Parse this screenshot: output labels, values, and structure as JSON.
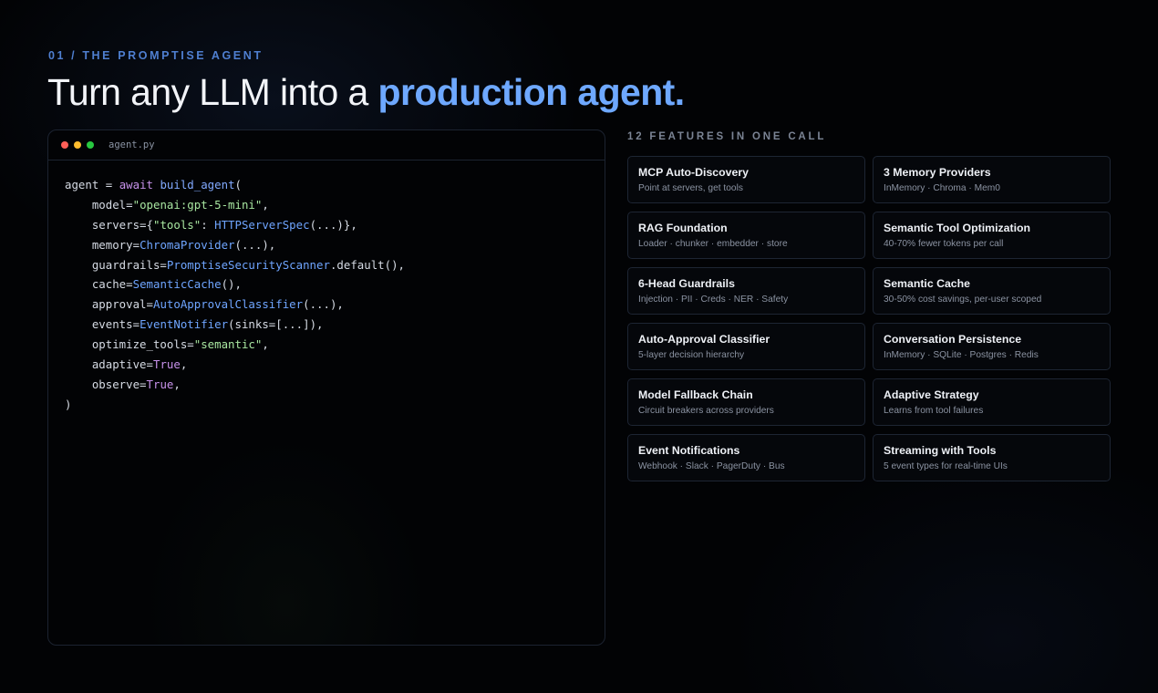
{
  "header": {
    "eyebrow": "01 / THE PROMPTISE AGENT",
    "title_plain": "Turn any LLM into a ",
    "title_accent": "production agent."
  },
  "editor": {
    "filename": "agent.py",
    "code": {
      "l1_a": "agent = ",
      "l1_kw": "await",
      "l1_sp": " ",
      "l1_fn": "build_agent",
      "l1_b": "(",
      "l2_a": "    model=",
      "l2_str": "\"openai:gpt-5-mini\"",
      "l2_b": ",",
      "l3_a": "    servers={",
      "l3_str": "\"tools\"",
      "l3_b": ": ",
      "l3_cls": "HTTPServerSpec",
      "l3_c": "(...)},",
      "l4_a": "    memory=",
      "l4_cls": "ChromaProvider",
      "l4_b": "(...),",
      "l5_a": "    guardrails=",
      "l5_cls": "PromptiseSecurityScanner",
      "l5_b": ".default(),",
      "l6_a": "    cache=",
      "l6_cls": "SemanticCache",
      "l6_b": "(),",
      "l7_a": "    approval=",
      "l7_cls": "AutoApprovalClassifier",
      "l7_b": "(...),",
      "l8_a": "    events=",
      "l8_cls": "EventNotifier",
      "l8_b": "(sinks=[...]),",
      "l9_a": "    optimize_tools=",
      "l9_str": "\"semantic\"",
      "l9_b": ",",
      "l10_a": "    adaptive=",
      "l10_bool": "True",
      "l10_b": ",",
      "l11_a": "    observe=",
      "l11_bool": "True",
      "l11_b": ",",
      "l12": ")"
    },
    "colors": {
      "dot_red": "#ff5f57",
      "dot_yellow": "#febc2e",
      "dot_green": "#28c840"
    }
  },
  "features": {
    "heading": "12 FEATURES IN ONE CALL",
    "items": [
      {
        "title": "MCP Auto-Discovery",
        "desc": "Point at servers, get tools"
      },
      {
        "title": "3 Memory Providers",
        "desc": "InMemory · Chroma · Mem0"
      },
      {
        "title": "RAG Foundation",
        "desc": "Loader · chunker · embedder · store"
      },
      {
        "title": "Semantic Tool Optimization",
        "desc": "40-70% fewer tokens per call"
      },
      {
        "title": "6-Head Guardrails",
        "desc": "Injection · PII · Creds · NER · Safety"
      },
      {
        "title": "Semantic Cache",
        "desc": "30-50% cost savings, per-user scoped"
      },
      {
        "title": "Auto-Approval Classifier",
        "desc": "5-layer decision hierarchy"
      },
      {
        "title": "Conversation Persistence",
        "desc": "InMemory · SQLite · Postgres · Redis"
      },
      {
        "title": "Model Fallback Chain",
        "desc": "Circuit breakers across providers"
      },
      {
        "title": "Adaptive Strategy",
        "desc": "Learns from tool failures"
      },
      {
        "title": "Event Notifications",
        "desc": "Webhook · Slack · PagerDuty · Bus"
      },
      {
        "title": "Streaming with Tools",
        "desc": "5 event types for real-time UIs"
      }
    ]
  },
  "colors": {
    "accent": "#6ea8ff",
    "eyebrow": "#4f7fd0",
    "background": "#020305"
  }
}
